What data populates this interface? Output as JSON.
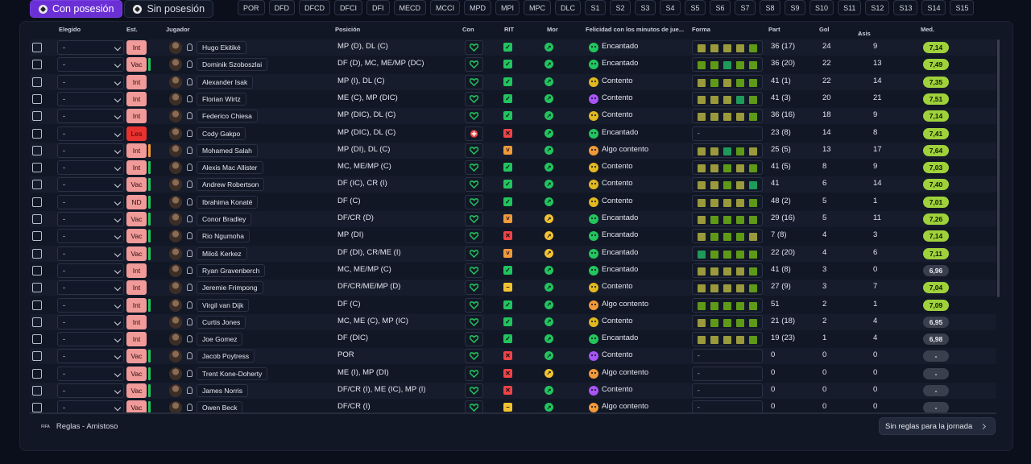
{
  "toggle": {
    "with_possession": "Con posesión",
    "without_possession": "Sin posesión"
  },
  "filters": [
    "POR",
    "DFD",
    "DFCD",
    "DFCI",
    "DFI",
    "MECD",
    "MCCI",
    "MPD",
    "MPI",
    "MPC",
    "DLC",
    "S1",
    "S2",
    "S3",
    "S4",
    "S5",
    "S6",
    "S7",
    "S8",
    "S9",
    "S10",
    "S11",
    "S12",
    "S13",
    "S14",
    "S15"
  ],
  "columns": {
    "elegido": "Elegido",
    "est": "Est.",
    "jugador": "Jugador",
    "posicion": "Posición",
    "con": "Con",
    "rit": "RIT",
    "mor": "Mor",
    "felicidad": "Felicidad con los minutos de jue...",
    "forma": "Forma",
    "part": "Part",
    "gol": "Gol",
    "asis": "Asis",
    "med": "Med.",
    "sort_icon": "↓"
  },
  "select_default": "-",
  "colors": {
    "green": "#21c55d",
    "yellow": "#f2c230",
    "orange": "#f29a3a",
    "red": "#ef4444",
    "forma_olive": "#9a9a3c",
    "forma_green": "#5e9a18",
    "forma_teal": "#1f9a5a",
    "happy": "#22c55e",
    "content": "#e1b820",
    "purple": "#a855f7",
    "med_green": "#9fd23a",
    "med_grey": "#3a3f4d"
  },
  "players": [
    {
      "name": "Hugo Ekitiké",
      "status": "Int",
      "bar": "",
      "pos": "MP (D), DL (C)",
      "rit": "ok",
      "mor": "green",
      "fel": "Encantado",
      "fel_c": "happy",
      "form": [
        "o",
        "o",
        "o",
        "o",
        "g"
      ],
      "part": "36 (17)",
      "gol": "24",
      "asis": "9",
      "med": "7,14",
      "med_c": "green"
    },
    {
      "name": "Dominik Szoboszlai",
      "status": "Vac",
      "bar": "#22c55e",
      "pos": "DF (D), MC, ME/MP (DC)",
      "rit": "ok",
      "mor": "green",
      "fel": "Encantado",
      "fel_c": "happy",
      "form": [
        "g",
        "g",
        "t",
        "g",
        "g"
      ],
      "part": "36 (20)",
      "gol": "22",
      "asis": "13",
      "med": "7,49",
      "med_c": "green"
    },
    {
      "name": "Alexander Isak",
      "status": "Int",
      "bar": "",
      "pos": "MP (I), DL (C)",
      "rit": "ok",
      "mor": "green",
      "fel": "Contento",
      "fel_c": "content",
      "form": [
        "o",
        "g",
        "o",
        "g",
        "g"
      ],
      "part": "41 (1)",
      "gol": "22",
      "asis": "14",
      "med": "7,35",
      "med_c": "green"
    },
    {
      "name": "Florian Wirtz",
      "status": "Int",
      "bar": "",
      "pos": "ME (C), MP (DIC)",
      "rit": "ok",
      "mor": "green",
      "fel": "Contento",
      "fel_c": "purple",
      "form": [
        "o",
        "o",
        "o",
        "t",
        "g"
      ],
      "part": "41 (3)",
      "gol": "20",
      "asis": "21",
      "med": "7,51",
      "med_c": "green"
    },
    {
      "name": "Federico Chiesa",
      "status": "Int",
      "bar": "",
      "pos": "MP (DIC), DL (C)",
      "rit": "ok",
      "mor": "green",
      "fel": "Contento",
      "fel_c": "content",
      "form": [
        "o",
        "o",
        "o",
        "o",
        "g"
      ],
      "part": "36 (16)",
      "gol": "18",
      "asis": "9",
      "med": "7,14",
      "med_c": "green"
    },
    {
      "name": "Cody Gakpo",
      "status": "Les",
      "bar": "",
      "pos": "MP (DIC), DL (C)",
      "rit": "x",
      "mor": "green",
      "fel": "Encantado",
      "fel_c": "happy",
      "form": [],
      "part": "23 (8)",
      "gol": "14",
      "asis": "8",
      "med": "7,41",
      "med_c": "green",
      "con_red": true
    },
    {
      "name": "Mohamed Salah",
      "status": "Int",
      "bar": "#f29a3a",
      "pos": "MP (DI), DL (C)",
      "rit": "warn",
      "mor": "green",
      "fel": "Algo contento",
      "fel_c": "orange",
      "form": [
        "o",
        "o",
        "t",
        "g",
        "o"
      ],
      "part": "25 (5)",
      "gol": "13",
      "asis": "17",
      "med": "7,64",
      "med_c": "green"
    },
    {
      "name": "Alexis Mac Allister",
      "status": "Int",
      "bar": "#22c55e",
      "pos": "MC, ME/MP (C)",
      "rit": "ok",
      "mor": "green",
      "fel": "Contento",
      "fel_c": "content",
      "form": [
        "o",
        "o",
        "g",
        "o",
        "g"
      ],
      "part": "41 (5)",
      "gol": "8",
      "asis": "9",
      "med": "7,03",
      "med_c": "green"
    },
    {
      "name": "Andrew Robertson",
      "status": "Vac",
      "bar": "#22c55e",
      "pos": "DF (IC), CR (I)",
      "rit": "ok",
      "mor": "green",
      "fel": "Contento",
      "fel_c": "content",
      "form": [
        "o",
        "o",
        "g",
        "o",
        "t"
      ],
      "part": "41",
      "gol": "6",
      "asis": "14",
      "med": "7,40",
      "med_c": "green"
    },
    {
      "name": "Ibrahima Konaté",
      "status": "ND",
      "bar": "#22c55e",
      "pos": "DF (C)",
      "rit": "ok",
      "mor": "green",
      "fel": "Contento",
      "fel_c": "content",
      "form": [
        "o",
        "o",
        "o",
        "o",
        "g"
      ],
      "part": "48 (2)",
      "gol": "5",
      "asis": "1",
      "med": "7,01",
      "med_c": "green"
    },
    {
      "name": "Conor Bradley",
      "status": "Vac",
      "bar": "#22c55e",
      "pos": "DF/CR (D)",
      "rit": "warn",
      "mor": "yellow",
      "fel": "Encantado",
      "fel_c": "happy",
      "form": [
        "o",
        "g",
        "g",
        "g",
        "g"
      ],
      "part": "29 (16)",
      "gol": "5",
      "asis": "11",
      "med": "7,26",
      "med_c": "green"
    },
    {
      "name": "Rio Ngumoha",
      "status": "Vac",
      "bar": "#22c55e",
      "pos": "MP (DI)",
      "rit": "x",
      "mor": "yellow",
      "fel": "Encantado",
      "fel_c": "happy",
      "form": [
        "o",
        "g",
        "g",
        "g",
        "o"
      ],
      "part": "7 (8)",
      "gol": "4",
      "asis": "3",
      "med": "7,14",
      "med_c": "green"
    },
    {
      "name": "Miloš Kerkez",
      "status": "Vac",
      "bar": "#22c55e",
      "pos": "DF (DI), CR/ME (I)",
      "rit": "warn",
      "mor": "yellow",
      "fel": "Encantado",
      "fel_c": "happy",
      "form": [
        "t",
        "g",
        "g",
        "g",
        "g"
      ],
      "part": "22 (20)",
      "gol": "4",
      "asis": "6",
      "med": "7,11",
      "med_c": "green"
    },
    {
      "name": "Ryan Gravenberch",
      "status": "Int",
      "bar": "",
      "pos": "MC, ME/MP (C)",
      "rit": "ok",
      "mor": "green",
      "fel": "Encantado",
      "fel_c": "happy",
      "form": [
        "o",
        "o",
        "o",
        "o",
        "g"
      ],
      "part": "41 (8)",
      "gol": "3",
      "asis": "0",
      "med": "6,96",
      "med_c": "grey"
    },
    {
      "name": "Jeremie Frimpong",
      "status": "Int",
      "bar": "",
      "pos": "DF/CR/ME/MP (D)",
      "rit": "warn_y",
      "mor": "green",
      "fel": "Contento",
      "fel_c": "content",
      "form": [
        "o",
        "o",
        "o",
        "o",
        "g"
      ],
      "part": "27 (9)",
      "gol": "3",
      "asis": "7",
      "med": "7,04",
      "med_c": "green"
    },
    {
      "name": "Virgil van Dijk",
      "status": "Int",
      "bar": "#22c55e",
      "pos": "DF (C)",
      "rit": "ok",
      "mor": "green",
      "fel": "Algo contento",
      "fel_c": "orange",
      "form": [
        "g",
        "g",
        "g",
        "g",
        "g"
      ],
      "part": "51",
      "gol": "2",
      "asis": "1",
      "med": "7,09",
      "med_c": "green"
    },
    {
      "name": "Curtis Jones",
      "status": "Int",
      "bar": "",
      "pos": "MC, ME (C), MP (IC)",
      "rit": "ok",
      "mor": "green",
      "fel": "Contento",
      "fel_c": "content",
      "form": [
        "o",
        "g",
        "g",
        "g",
        "g"
      ],
      "part": "21 (18)",
      "gol": "2",
      "asis": "4",
      "med": "6,95",
      "med_c": "grey"
    },
    {
      "name": "Joe Gomez",
      "status": "Int",
      "bar": "",
      "pos": "DF (DIC)",
      "rit": "ok",
      "mor": "green",
      "fel": "Encantado",
      "fel_c": "happy",
      "form": [
        "o",
        "o",
        "o",
        "o",
        "g"
      ],
      "part": "19 (23)",
      "gol": "1",
      "asis": "4",
      "med": "6,98",
      "med_c": "grey"
    },
    {
      "name": "Jacob Poytress",
      "status": "Vac",
      "bar": "#22c55e",
      "pos": "POR",
      "rit": "x",
      "mor": "green",
      "fel": "Contento",
      "fel_c": "purple",
      "form": [],
      "part": "0",
      "gol": "0",
      "asis": "0",
      "med": "-",
      "med_c": "grey"
    },
    {
      "name": "Trent Kone-Doherty",
      "status": "Vac",
      "bar": "#22c55e",
      "pos": "ME (I), MP (DI)",
      "rit": "x",
      "mor": "yellow",
      "fel": "Algo contento",
      "fel_c": "orange",
      "form": [],
      "part": "0",
      "gol": "0",
      "asis": "0",
      "med": "-",
      "med_c": "grey"
    },
    {
      "name": "James Norris",
      "status": "Vac",
      "bar": "#22c55e",
      "pos": "DF/CR (I), ME (IC), MP (I)",
      "rit": "x",
      "mor": "green",
      "fel": "Contento",
      "fel_c": "purple",
      "form": [],
      "part": "0",
      "gol": "0",
      "asis": "0",
      "med": "-",
      "med_c": "grey"
    },
    {
      "name": "Owen Beck",
      "status": "Vac",
      "bar": "#22c55e",
      "pos": "DF/CR (I)",
      "rit": "warn_y",
      "mor": "green",
      "fel": "Algo contento",
      "fel_c": "orange",
      "form": [],
      "part": "0",
      "gol": "0",
      "asis": "0",
      "med": "-",
      "med_c": "grey"
    }
  ],
  "footer": {
    "brand": "FIFA",
    "rules": "Reglas - Amistoso",
    "round_button": "Sin reglas para la jornada"
  }
}
